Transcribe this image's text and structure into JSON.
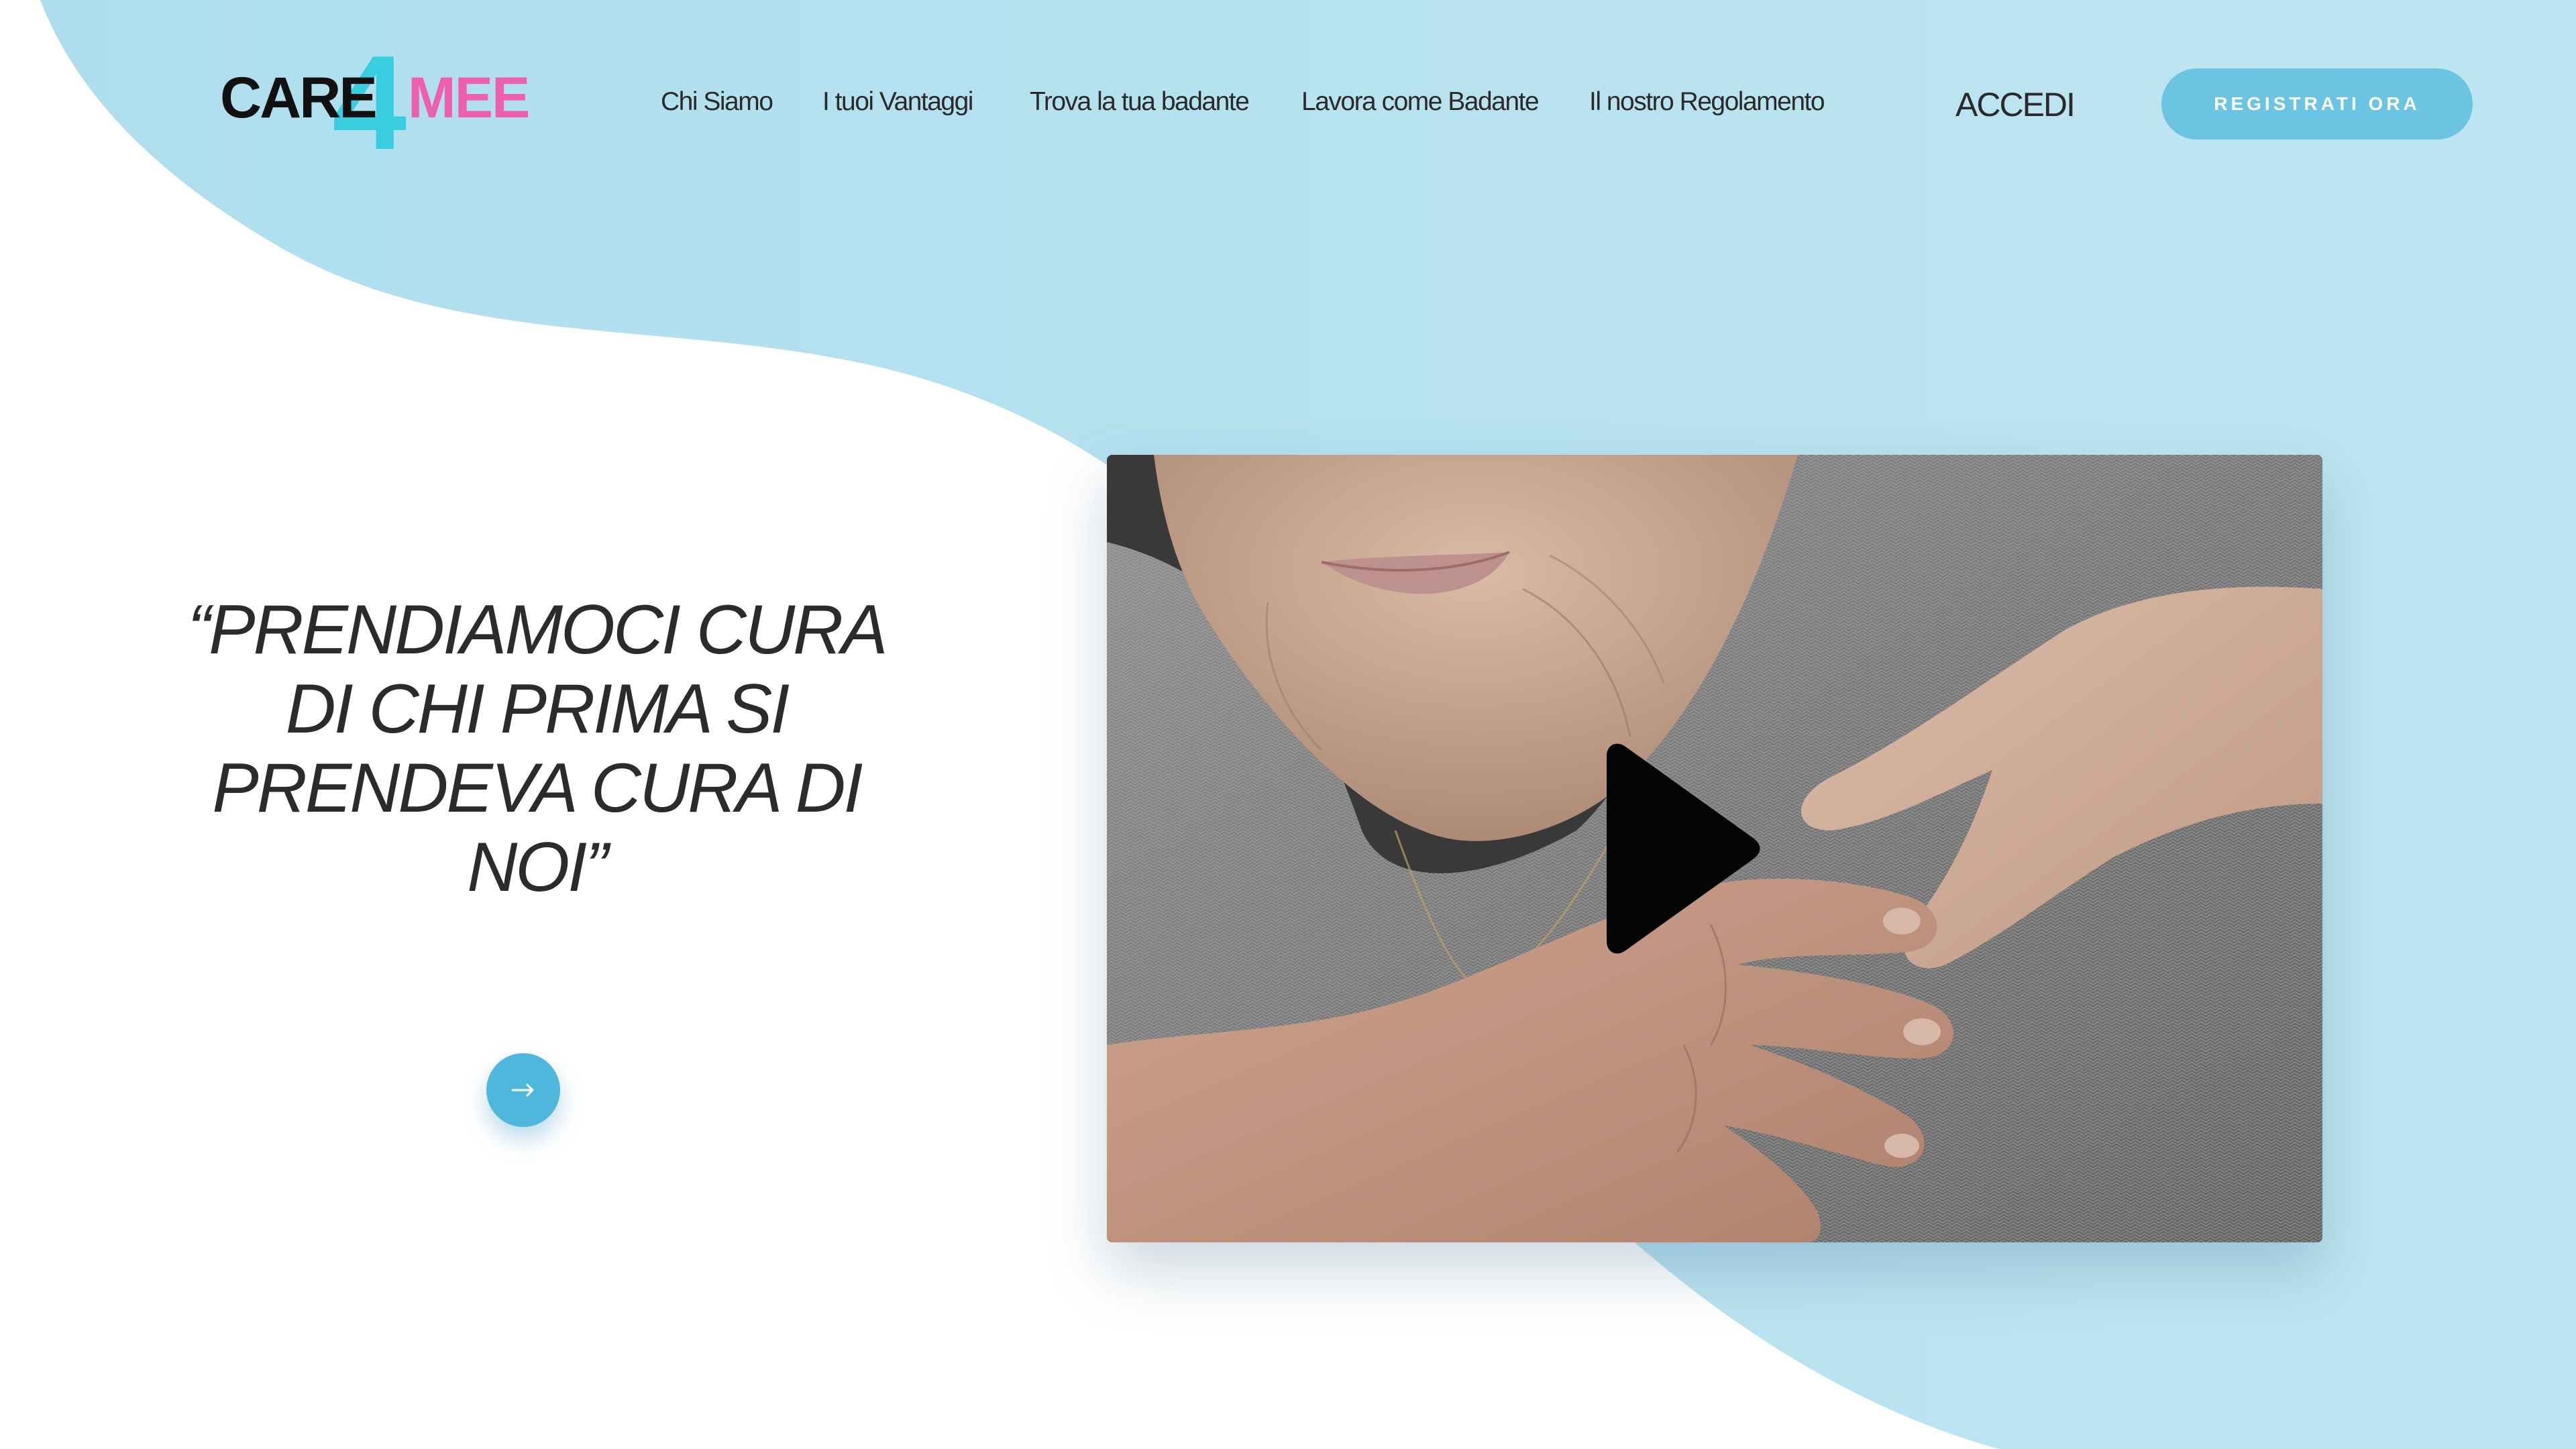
{
  "logo": {
    "part1": "CARE",
    "part2": "4",
    "part3": "MEE"
  },
  "nav": {
    "items": [
      {
        "label": "Chi Siamo"
      },
      {
        "label": "I tuoi Vantaggi"
      },
      {
        "label": "Trova la tua badante"
      },
      {
        "label": "Lavora come Badante"
      },
      {
        "label": "Il nostro Regolamento"
      }
    ],
    "login_label": "ACCEDI",
    "register_label": "REGISTRATI ORA"
  },
  "hero": {
    "quote_lines": [
      "“PRENDIAMOCI CURA",
      "DI CHI PRIMA SI",
      "PRENDEVA CURA DI",
      "NOI”"
    ],
    "cta_icon": "arrow-right-icon"
  },
  "video": {
    "play_icon": "play-icon"
  },
  "colors": {
    "accent_blue": "#4fb7dc",
    "button_blue": "#6cc4e3",
    "background_blue": "#b0e0ec",
    "logo_cyan": "#38cde0",
    "logo_pink": "#ee5fae",
    "text_dark": "#2b2b2b"
  }
}
